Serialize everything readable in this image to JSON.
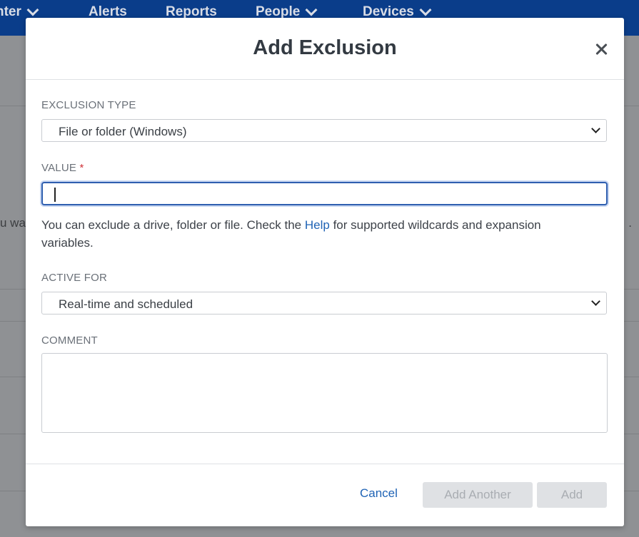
{
  "nav": {
    "items": [
      {
        "label": "nter",
        "has_dropdown": true
      },
      {
        "label": "Alerts",
        "has_dropdown": false
      },
      {
        "label": "Reports",
        "has_dropdown": false
      },
      {
        "label": "People",
        "has_dropdown": true
      },
      {
        "label": "Devices",
        "has_dropdown": true
      }
    ]
  },
  "background": {
    "partial_text": "u wa",
    "partial_text_right": "."
  },
  "modal": {
    "title": "Add Exclusion",
    "exclusion_type": {
      "label": "EXCLUSION TYPE",
      "selected": "File or folder (Windows)"
    },
    "value": {
      "label": "VALUE",
      "required_mark": "*",
      "current_value": ""
    },
    "help": {
      "text_before": "You can exclude a drive, folder or file. Check the ",
      "link": "Help",
      "text_after": " for supported wildcards and expansion variables."
    },
    "active_for": {
      "label": "ACTIVE FOR",
      "selected": "Real-time and scheduled"
    },
    "comment": {
      "label": "COMMENT",
      "current_value": ""
    },
    "buttons": {
      "cancel": "Cancel",
      "add_another": "Add Another",
      "add": "Add"
    }
  }
}
